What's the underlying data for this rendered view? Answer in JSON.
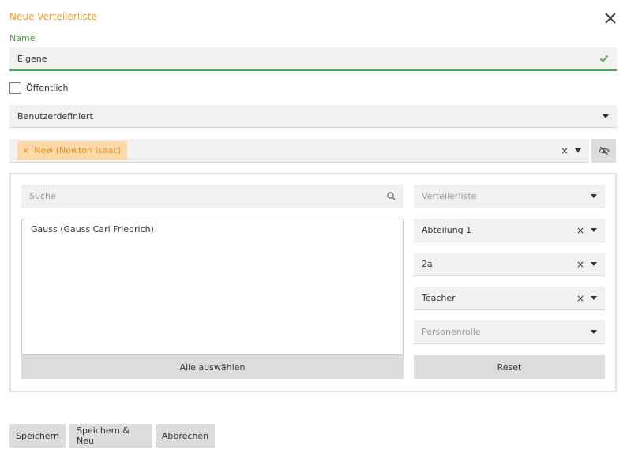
{
  "dialog": {
    "title": "Neue Verteilerliste"
  },
  "name": {
    "label": "Name",
    "value": "Eigene"
  },
  "public": {
    "label": "Öffentlich",
    "checked": false
  },
  "type_select": {
    "value": "Benutzerdefiniert"
  },
  "members": {
    "tags": [
      {
        "label": "New (Newton Isaac)"
      }
    ]
  },
  "search": {
    "placeholder": "Suche"
  },
  "list": {
    "items": [
      "Gauss (Gauss Carl Friedrich)"
    ],
    "select_all_label": "Alle auswählen"
  },
  "filters": {
    "verteilerliste": {
      "placeholder": "Verteilerliste"
    },
    "abteilung": {
      "value": "Abteilung 1"
    },
    "klasse": {
      "value": "2a"
    },
    "rolle": {
      "value": "Teacher"
    },
    "personenrolle": {
      "placeholder": "Personenrolle"
    },
    "reset_label": "Reset"
  },
  "actions": {
    "save": "Speichern",
    "save_new": "Speichern & Neu",
    "cancel": "Abbrechen"
  },
  "colors": {
    "accent_orange": "#f0a030",
    "valid_green": "#4caf50",
    "tag_bg": "#fdd9a8"
  },
  "icons": {
    "close": "close-icon",
    "check": "check-icon",
    "search": "search-icon",
    "eye": "eye-slash-icon"
  }
}
